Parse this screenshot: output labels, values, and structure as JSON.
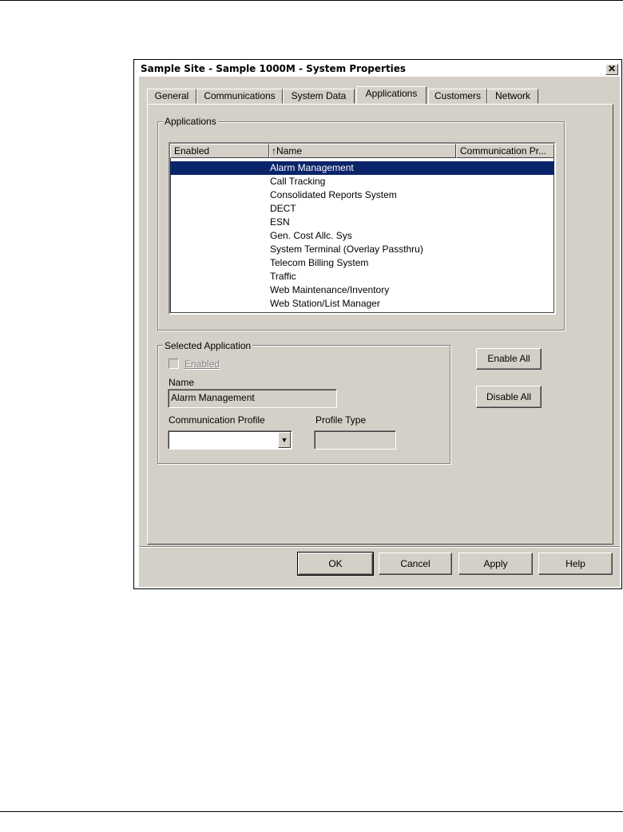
{
  "window": {
    "title": "Sample Site - Sample 1000M - System Properties",
    "close_glyph": "✕"
  },
  "tabs": [
    {
      "label": "General",
      "active": false
    },
    {
      "label": "Communications",
      "active": false
    },
    {
      "label": "System Data",
      "active": false
    },
    {
      "label": "Applications",
      "active": true
    },
    {
      "label": "Customers",
      "active": false
    },
    {
      "label": "Network",
      "active": false
    }
  ],
  "applications_group": {
    "legend": "Applications",
    "columns": [
      "Enabled",
      "Name",
      "Communication Pr..."
    ],
    "sort_indicator": "↑",
    "rows": [
      "Alarm Management",
      "Call Tracking",
      "Consolidated Reports System",
      "DECT",
      "ESN",
      "Gen. Cost Allc. Sys",
      "System Terminal (Overlay Passthru)",
      "Telecom Billing System",
      "Traffic",
      "Web Maintenance/Inventory",
      "Web Station/List Manager"
    ],
    "selected_index": 0
  },
  "selected_application": {
    "legend": "Selected Application",
    "enabled_label": "Enabled",
    "enabled_checked": false,
    "name_label": "Name",
    "name_value": "Alarm Management",
    "comm_profile_label": "Communication Profile",
    "comm_profile_value": "",
    "profile_type_label": "Profile Type",
    "profile_type_value": ""
  },
  "side_buttons": {
    "enable_all": "Enable All",
    "disable_all": "Disable All"
  },
  "footer_buttons": {
    "ok": "OK",
    "cancel": "Cancel",
    "apply": "Apply",
    "help": "Help"
  },
  "colors": {
    "dialog_bg": "#d4d0c8",
    "selection": "#0a246a"
  }
}
